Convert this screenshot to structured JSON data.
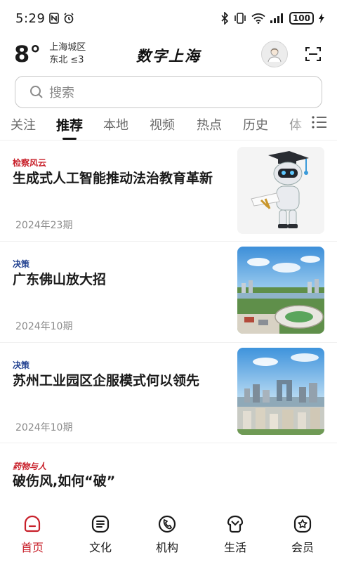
{
  "status_bar": {
    "time": "5:29",
    "battery": "100"
  },
  "header": {
    "temperature": "8°",
    "location": "上海城区",
    "wind": "东北 ≤3",
    "logo": "数字上海"
  },
  "search": {
    "placeholder": "搜索"
  },
  "tabs": [
    {
      "label": "关注"
    },
    {
      "label": "推荐",
      "active": true
    },
    {
      "label": "本地"
    },
    {
      "label": "视频"
    },
    {
      "label": "热点"
    },
    {
      "label": "历史"
    },
    {
      "label": "体"
    }
  ],
  "articles": [
    {
      "category": "检察风云",
      "category_color": "#c8202a",
      "title": "生成式人工智能推动法治教育革新",
      "issue": "2024年23期",
      "thumb": "robot-graduate-image"
    },
    {
      "category": "决策",
      "category_color": "#1f3f8f",
      "title": "广东佛山放大招",
      "issue": "2024年10期",
      "thumb": "foshan-stadium-aerial-image"
    },
    {
      "category": "决策",
      "category_color": "#1f3f8f",
      "title": "苏州工业园区企服模式何以领先",
      "issue": "2024年10期",
      "thumb": "suzhou-skyline-image"
    },
    {
      "category": "药物与人",
      "category_color": "#c8202a",
      "title": "破伤风,如何“破”",
      "issue": "",
      "thumb": ""
    }
  ],
  "bottom_nav": [
    {
      "label": "首页",
      "icon": "home-icon",
      "active": true
    },
    {
      "label": "文化",
      "icon": "culture-icon"
    },
    {
      "label": "机构",
      "icon": "institution-icon"
    },
    {
      "label": "生活",
      "icon": "life-icon"
    },
    {
      "label": "会员",
      "icon": "member-icon"
    }
  ],
  "colors": {
    "accent": "#c8202a",
    "category_blue": "#1f3f8f"
  }
}
